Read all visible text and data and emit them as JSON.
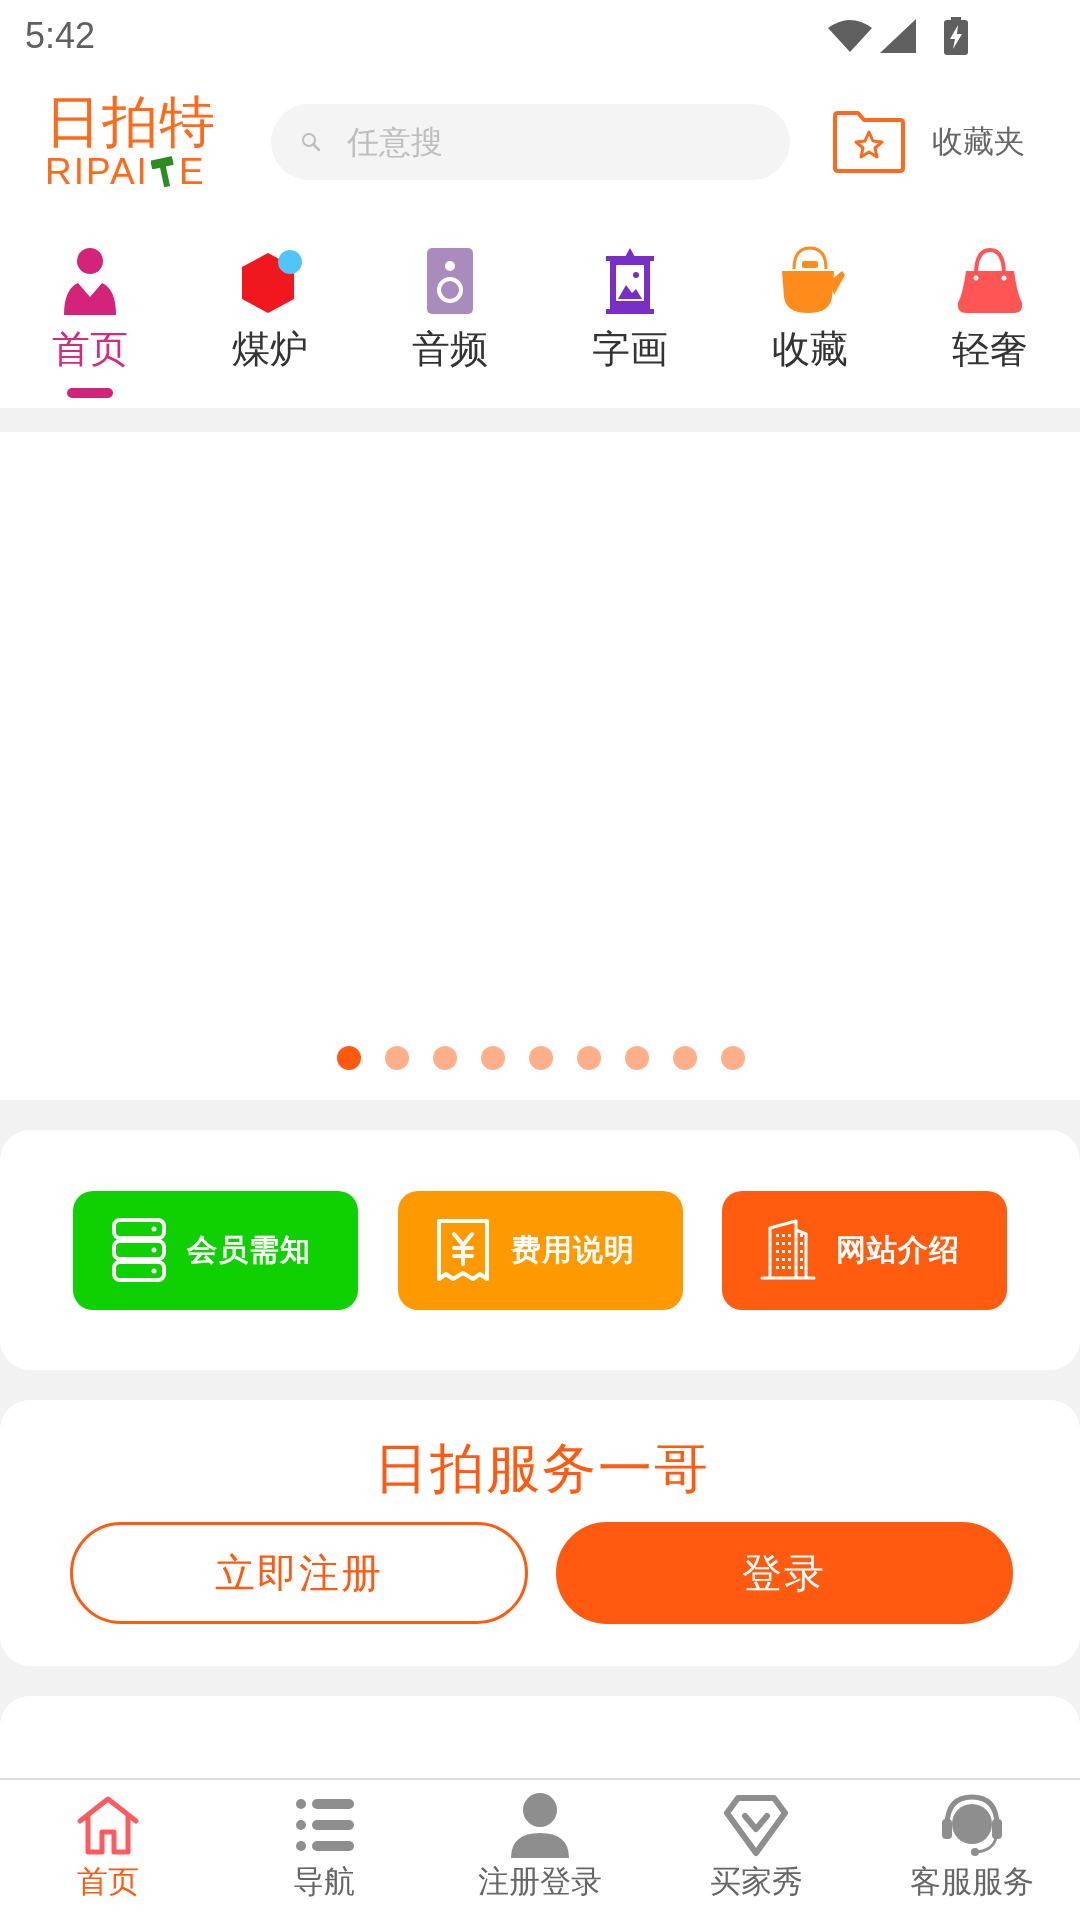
{
  "status_bar": {
    "time": "5:42"
  },
  "header": {
    "logo": {
      "title": "日拍特",
      "latin_start": "RIPAI",
      "latin_end": "E"
    },
    "search": {
      "placeholder": "任意搜"
    },
    "favorites": {
      "label": "收藏夹"
    }
  },
  "categories": [
    {
      "label": "首页",
      "kind": "person",
      "selected": true
    },
    {
      "label": "煤炉",
      "kind": "cube",
      "selected": false
    },
    {
      "label": "音频",
      "kind": "speaker",
      "selected": false
    },
    {
      "label": "字画",
      "kind": "scroll",
      "selected": false
    },
    {
      "label": "收藏",
      "kind": "teapot",
      "selected": false
    },
    {
      "label": "轻奢",
      "kind": "handbag",
      "selected": false
    }
  ],
  "carousel": {
    "dots": [
      {
        "selected": true
      },
      {
        "selected": false
      },
      {
        "selected": false
      },
      {
        "selected": false
      },
      {
        "selected": false
      },
      {
        "selected": false
      },
      {
        "selected": false
      },
      {
        "selected": false
      },
      {
        "selected": false
      }
    ]
  },
  "quick_links": [
    {
      "label": "会员需知",
      "kind": "servers",
      "color": "#0fd000"
    },
    {
      "label": "费用说明",
      "kind": "receipt",
      "color": "#ff9900"
    },
    {
      "label": "网站介绍",
      "kind": "building",
      "color": "#ff5c0f"
    }
  ],
  "service": {
    "title": "日拍服务一哥",
    "buttons": [
      {
        "label": "立即注册",
        "kind": "outline"
      },
      {
        "label": "登录",
        "kind": "filled"
      }
    ]
  },
  "bottom_nav": [
    {
      "label": "首页",
      "kind": "home",
      "selected": true
    },
    {
      "label": "导航",
      "kind": "list",
      "selected": false
    },
    {
      "label": "注册登录",
      "kind": "person",
      "selected": false
    },
    {
      "label": "买家秀",
      "kind": "diamond",
      "selected": false
    },
    {
      "label": "客服服务",
      "kind": "headset",
      "selected": false
    }
  ]
}
